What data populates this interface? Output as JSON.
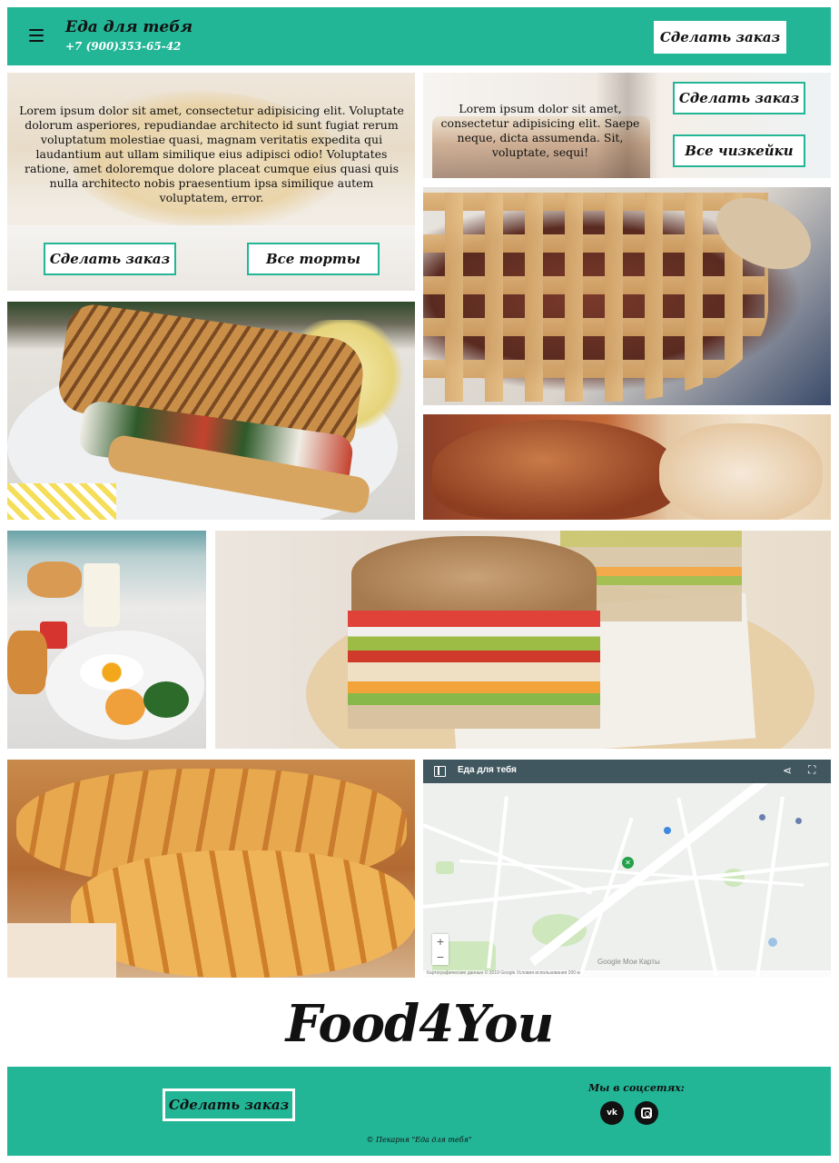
{
  "header": {
    "title": "Еда для тебя",
    "phone": "+7 (900)353-65-42",
    "order_button": "Сделать заказ",
    "menu_icon": "hamburger-menu-icon",
    "background_color": "#22b596"
  },
  "tiles": {
    "cakes": {
      "text": "Lorem ipsum dolor sit amet, consectetur adipisicing elit. Voluptate dolorum asperiores, repudiandae architecto id sunt fugiat rerum voluptatum molestiae quasi, magnam veritatis expedita qui laudantium aut ullam similique eius adipisci odio! Voluptates ratione, amet doloremque dolore placeat cumque eius quasi quis nulla architecto nobis praesentium ipsa similique autem voluptatem, error.",
      "order_button": "Сделать заказ",
      "all_button": "Все торты"
    },
    "cheesecakes": {
      "text": "Lorem ipsum dolor sit amet, consectetur adipisicing elit. Saepe neque, dicta assumenda. Sit, voluptate, sequi!",
      "order_button": "Сделать заказ",
      "all_button": "Все чизкейки"
    }
  },
  "map": {
    "title": "Еда для тебя",
    "zoom_in": "+",
    "zoom_out": "−",
    "brand": "Google Мои Карты",
    "share_icon": "share-icon",
    "fullscreen_icon": "fullscreen-icon",
    "attribution": "Картографические данные © 2019 Google   Условия использования   200 м"
  },
  "logo": "Food4You",
  "footer": {
    "order_button": "Сделать заказ",
    "social_label": "Мы в соцсетях:",
    "vk_label": "vk",
    "vk_icon": "vk-icon",
    "instagram_icon": "instagram-icon",
    "copyright": "© Пекарня \"Еда для тебя\"",
    "background_color": "#22b596"
  }
}
